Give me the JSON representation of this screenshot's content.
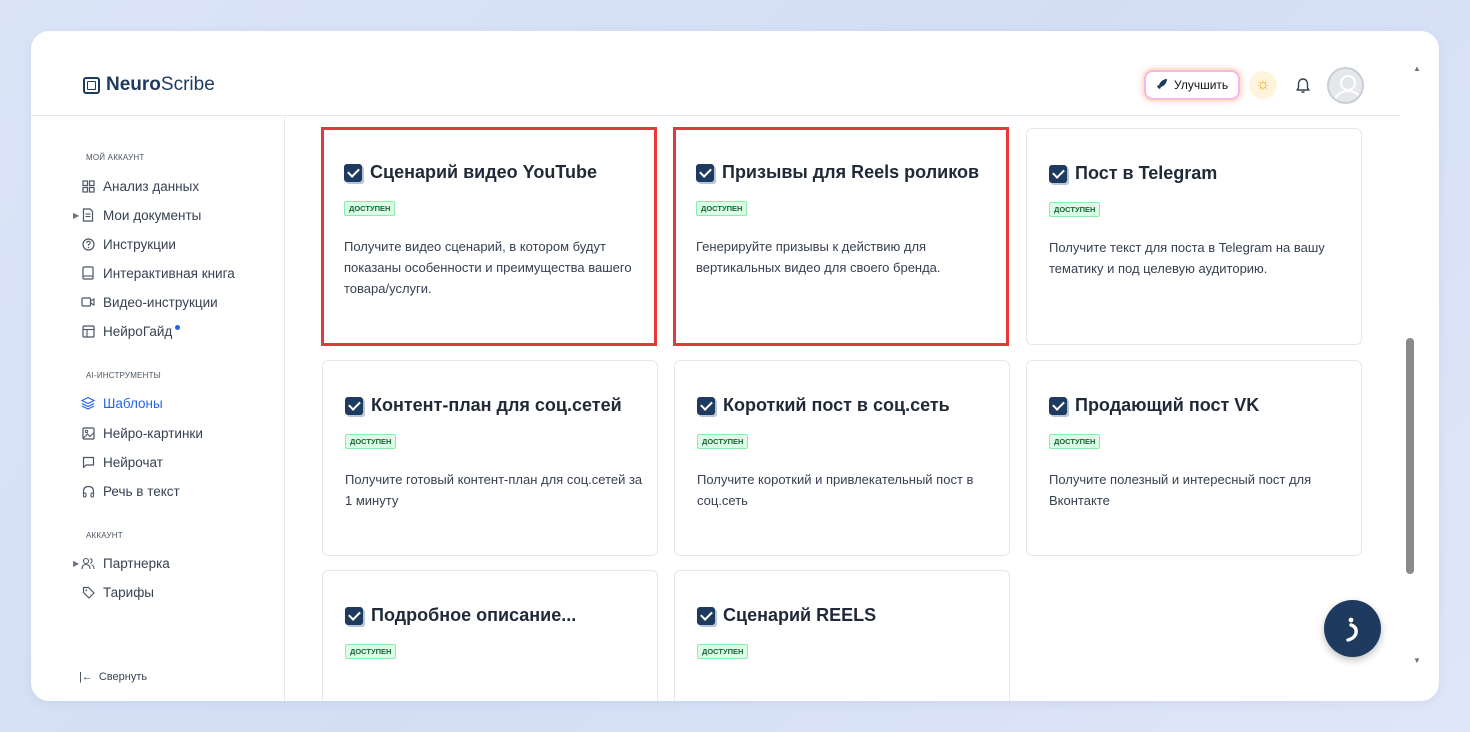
{
  "brand": {
    "name_bold": "Neuro",
    "name_rest": "Scribe"
  },
  "header": {
    "upgrade_label": "Улучшить"
  },
  "sidebar": {
    "sections": [
      {
        "title": "МОЙ АККАУНТ"
      },
      {
        "title": "AI-ИНСТРУМЕНТЫ"
      },
      {
        "title": "АККАУНТ"
      }
    ],
    "items": [
      {
        "label": "Анализ данных",
        "icon": "grid-icon"
      },
      {
        "label": "Мои документы",
        "icon": "document-icon"
      },
      {
        "label": "Инструкции",
        "icon": "question-icon"
      },
      {
        "label": "Интерактивная книга",
        "icon": "book-icon"
      },
      {
        "label": "Видео-инструкции",
        "icon": "video-icon"
      },
      {
        "label": "НейроГайд",
        "icon": "layout-icon"
      },
      {
        "label": "Шаблоны",
        "icon": "layers-icon"
      },
      {
        "label": "Нейро-картинки",
        "icon": "image-icon"
      },
      {
        "label": "Нейрочат",
        "icon": "chat-icon"
      },
      {
        "label": "Речь в текст",
        "icon": "headphones-icon"
      },
      {
        "label": "Партнерка",
        "icon": "users-icon"
      },
      {
        "label": "Тарифы",
        "icon": "tag-icon"
      }
    ],
    "collapse_label": "Свернуть"
  },
  "cards": [
    {
      "title": "Сценарий видео YouTube",
      "badge": "ДОСТУПЕН",
      "description": "Получите видео сценарий, в котором будут показаны особенности и преимущества вашего товара/услуги."
    },
    {
      "title": "Призывы для Reels роликов",
      "badge": "ДОСТУПЕН",
      "description": "Генерируйте призывы к действию для вертикальных видео для своего бренда."
    },
    {
      "title": "Пост в Telegram",
      "badge": "ДОСТУПЕН",
      "description": "Получите текст для поста в Telegram на вашу тематику и под целевую аудиторию."
    },
    {
      "title": "Контент-план для соц.сетей",
      "badge": "ДОСТУПЕН",
      "description": "Получите готовый контент-план для соц.сетей за 1 минуту"
    },
    {
      "title": "Короткий пост в соц.сеть",
      "badge": "ДОСТУПЕН",
      "description": "Получите короткий и привлекательный пост в соц.сеть"
    },
    {
      "title": "Продающий пост VK",
      "badge": "ДОСТУПЕН",
      "description": "Получите полезный и интересный пост для Вконтакте"
    },
    {
      "title": "Подробное описание...",
      "badge": "ДОСТУПЕН",
      "description": ""
    },
    {
      "title": "Сценарий REELS",
      "badge": "ДОСТУПЕН",
      "description": ""
    }
  ],
  "colors": {
    "accent": "#2563eb",
    "brand_dark": "#1e3a5f",
    "highlight_border": "#e3393c",
    "badge_bg": "#dcfce7"
  }
}
